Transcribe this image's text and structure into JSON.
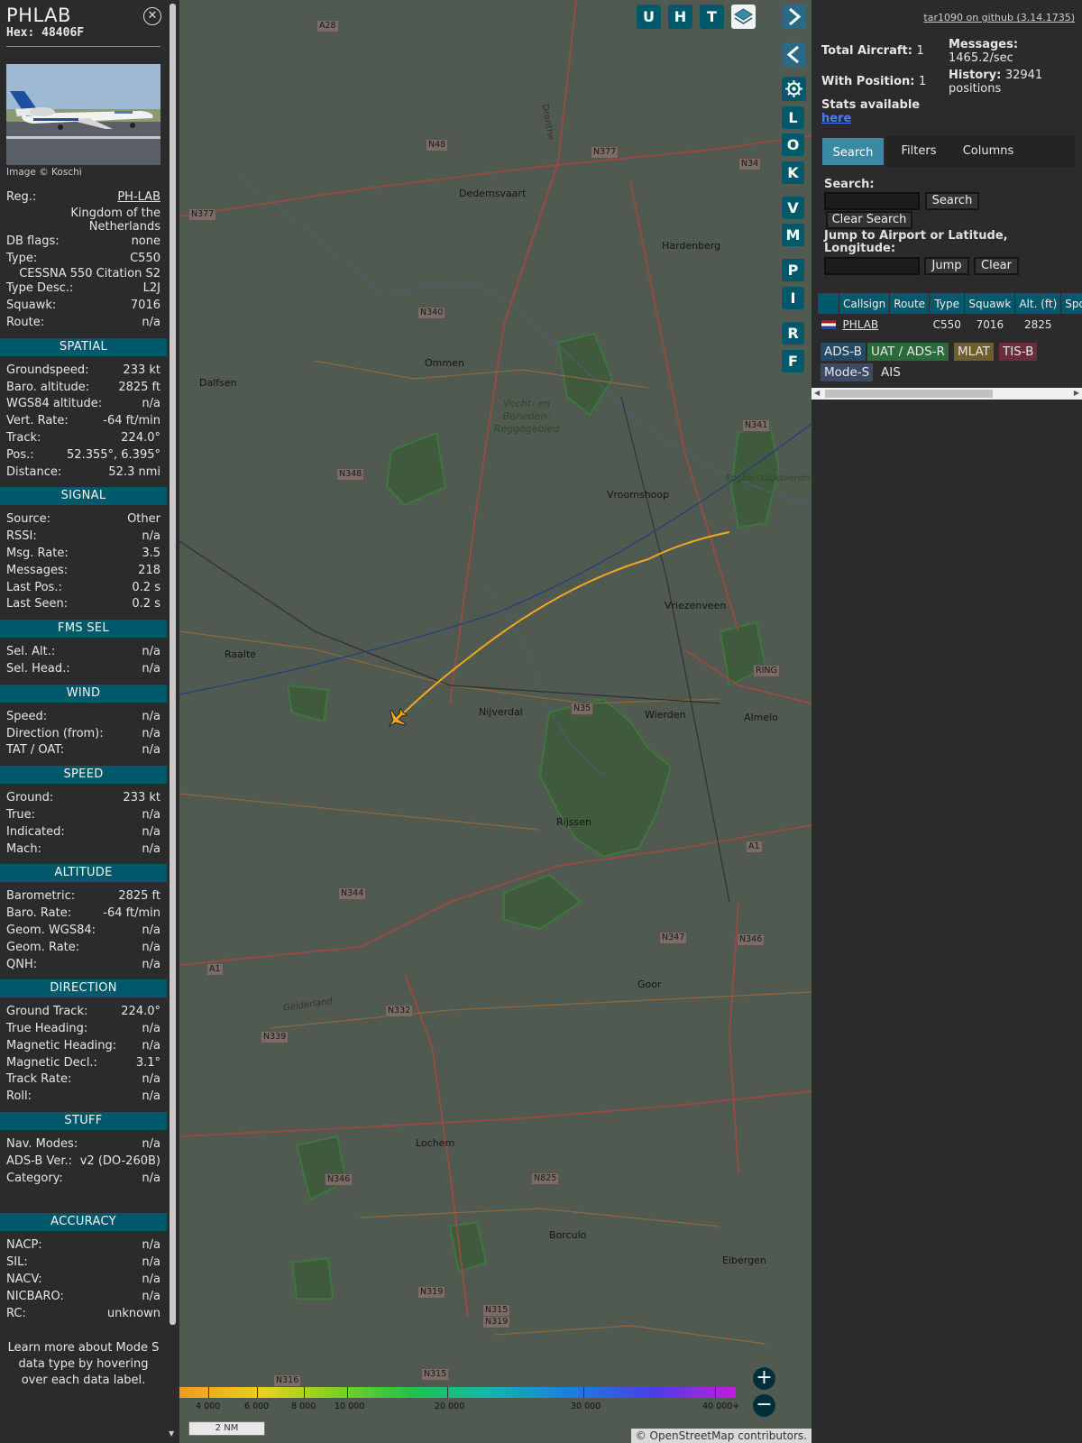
{
  "info": {
    "callsign": "PHLAB",
    "hex": "Hex: 48406F",
    "photo_credit": "Image © Koschi",
    "top_rows": [
      {
        "k": "Reg.:",
        "v": "PH-LAB",
        "link": true
      },
      {
        "full": "Kingdom of the Netherlands"
      },
      {
        "k": "DB flags:",
        "v": "none"
      },
      {
        "k": "Type:",
        "v": "C550"
      },
      {
        "full": "CESSNA 550 Citation S2"
      },
      {
        "k": "Type Desc.:",
        "v": "L2J"
      },
      {
        "k": "Squawk:",
        "v": "7016"
      },
      {
        "k": "Route:",
        "v": "n/a"
      }
    ],
    "sections": [
      {
        "title": "SPATIAL",
        "rows": [
          {
            "k": "Groundspeed:",
            "v": "233 kt"
          },
          {
            "k": "Baro. altitude:",
            "v": "2825 ft"
          },
          {
            "k": "WGS84 altitude:",
            "v": "n/a"
          },
          {
            "k": "Vert. Rate:",
            "v": "-64 ft/min"
          },
          {
            "k": "Track:",
            "v": "224.0°"
          },
          {
            "k": "Pos.:",
            "v": "52.355°, 6.395°"
          },
          {
            "k": "Distance:",
            "v": "52.3 nmi"
          }
        ]
      },
      {
        "title": "SIGNAL",
        "rows": [
          {
            "k": "Source:",
            "v": "Other"
          },
          {
            "k": "RSSI:",
            "v": "n/a"
          },
          {
            "k": "Msg. Rate:",
            "v": "3.5"
          },
          {
            "k": "Messages:",
            "v": "218"
          },
          {
            "k": "Last Pos.:",
            "v": "0.2 s"
          },
          {
            "k": "Last Seen:",
            "v": "0.2 s"
          }
        ]
      },
      {
        "title": "FMS SEL",
        "rows": [
          {
            "k": "Sel. Alt.:",
            "v": "n/a"
          },
          {
            "k": "Sel. Head.:",
            "v": "n/a"
          }
        ]
      },
      {
        "title": "WIND",
        "rows": [
          {
            "k": "Speed:",
            "v": "n/a"
          },
          {
            "k": "Direction (from):",
            "v": "n/a"
          },
          {
            "k": "TAT / OAT:",
            "v": "n/a"
          }
        ]
      },
      {
        "title": "SPEED",
        "rows": [
          {
            "k": "Ground:",
            "v": "233 kt"
          },
          {
            "k": "True:",
            "v": "n/a"
          },
          {
            "k": "Indicated:",
            "v": "n/a"
          },
          {
            "k": "Mach:",
            "v": "n/a"
          }
        ]
      },
      {
        "title": "ALTITUDE",
        "rows": [
          {
            "k": "Barometric:",
            "v": "2825 ft"
          },
          {
            "k": "Baro. Rate:",
            "v": "-64 ft/min"
          },
          {
            "k": "Geom. WGS84:",
            "v": "n/a"
          },
          {
            "k": "Geom. Rate:",
            "v": "n/a"
          },
          {
            "k": "QNH:",
            "v": "n/a"
          }
        ]
      },
      {
        "title": "DIRECTION",
        "rows": [
          {
            "k": "Ground Track:",
            "v": "224.0°"
          },
          {
            "k": "True Heading:",
            "v": "n/a"
          },
          {
            "k": "Magnetic Heading:",
            "v": "n/a"
          },
          {
            "k": "Magnetic Decl.:",
            "v": "3.1°"
          },
          {
            "k": "Track Rate:",
            "v": "n/a"
          },
          {
            "k": "Roll:",
            "v": "n/a"
          }
        ]
      },
      {
        "title": "STUFF",
        "rows": [
          {
            "k": "Nav. Modes:",
            "v": "n/a"
          },
          {
            "k": "ADS-B Ver.:",
            "v": "v2 (DO-260B)"
          },
          {
            "k": "Category:",
            "v": "n/a"
          }
        ]
      },
      {
        "title": "ACCURACY",
        "gap": 22,
        "rows": [
          {
            "k": "NACP:",
            "v": "n/a"
          },
          {
            "k": "SIL:",
            "v": "n/a"
          },
          {
            "k": "NACV:",
            "v": "n/a"
          },
          {
            "k": "NICBARO:",
            "v": "n/a"
          },
          {
            "k": "RC:",
            "v": "unknown"
          }
        ]
      }
    ],
    "learn_more": "Learn more about Mode S data type by hovering over each data label."
  },
  "map": {
    "top_buttons": [
      "U",
      "H",
      "T"
    ],
    "side_buttons": [
      "L",
      "O",
      "K",
      "V",
      "M",
      "P",
      "I",
      "R",
      "F"
    ],
    "places": [
      {
        "name": "Dedemsvaart"
      },
      {
        "name": "Hardenberg"
      },
      {
        "name": "Ommen"
      },
      {
        "name": "Dalfsen"
      },
      {
        "name": "Vroomshoop"
      },
      {
        "name": "Vriezenveen"
      },
      {
        "name": "Raalte"
      },
      {
        "name": "Nijverdal"
      },
      {
        "name": "Wierden"
      },
      {
        "name": "Almelo"
      },
      {
        "name": "Rijssen"
      },
      {
        "name": "Goor"
      },
      {
        "name": "Lochem"
      },
      {
        "name": "Borculo"
      },
      {
        "name": "Eibergen"
      },
      {
        "name": "Vecht- en Beneden-Reggegebied"
      },
      {
        "name": "Engbertsdijksvenen"
      },
      {
        "name": "Gelderland"
      },
      {
        "name": "Drenthe"
      }
    ],
    "roads": [
      "A28",
      "N48",
      "N377",
      "N34",
      "N377",
      "N340",
      "N348",
      "N341",
      "N35",
      "RING",
      "A1",
      "N344",
      "N347",
      "N346",
      "A1",
      "N332",
      "N339",
      "N346",
      "N825",
      "N319",
      "N315",
      "N319",
      "N316",
      "N315"
    ],
    "altitude_ticks": [
      "4 000",
      "6 000",
      "8 000",
      "10 000",
      "20 000",
      "30 000",
      "40 000+"
    ],
    "scale_label": "2 NM",
    "attribution": "© OpenStreetMap contributors."
  },
  "side": {
    "github": "tar1090 on github (3.14.1735)",
    "total_label": "Total Aircraft:",
    "total_value": "1",
    "withpos_label": "With Position:",
    "withpos_value": "1",
    "stats_label": "Stats available",
    "stats_link": "here",
    "messages_label": "Messages:",
    "messages_value": "1465.2/sec",
    "history_label": "History:",
    "history_value": "32941 positions",
    "tabs": [
      "Search",
      "Filters",
      "Columns"
    ],
    "search_label": "Search:",
    "search_button": "Search",
    "clear_search": "Clear Search",
    "jump_label": "Jump to Airport or Latitude, Longitude:",
    "jump_button": "Jump",
    "clear_button": "Clear",
    "columns": [
      "",
      "Callsign",
      "Route",
      "Type",
      "Squawk",
      "Alt. (ft)",
      "Spd."
    ],
    "rows": [
      {
        "callsign": "PHLAB",
        "route": "",
        "type": "C550",
        "squawk": "7016",
        "alt": "2825"
      }
    ],
    "sources": [
      {
        "label": "ADS-B",
        "color": "#234a66"
      },
      {
        "label": "UAT / ADS-R",
        "color": "#2b6a3a"
      },
      {
        "label": "MLAT",
        "color": "#6e5e30"
      },
      {
        "label": "TIS-B",
        "color": "#6a2d3a"
      },
      {
        "label": "Mode-S",
        "color": "#3c4a66"
      },
      {
        "label": "AIS",
        "color": "#2b2b2b"
      }
    ]
  }
}
